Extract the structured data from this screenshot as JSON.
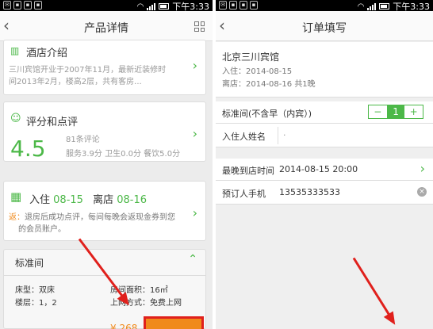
{
  "status_bar": {
    "time": "下午3:33"
  },
  "left": {
    "title": "产品详情",
    "intro": {
      "heading": "酒店介绍",
      "text_line1": "三川宾馆开业于2007年11月，最新近装修时",
      "text_line2": "间2013年2月，楼高2层，共有客房..."
    },
    "review": {
      "heading": "评分和点评",
      "score": "4.5",
      "count": "81条评论",
      "breakdown": "服务3.9分  卫生0.0分  餐饮5.0分"
    },
    "dates": {
      "checkin_label": "入住",
      "checkin_date": "08-15",
      "checkout_label": "离店",
      "checkout_date": "08-16",
      "promo_prefix": "返：",
      "promo_line1": "退房后成功点评，每间每晚会返现金券到您",
      "promo_line2": "的会员账户。"
    },
    "room": {
      "name": "标准间",
      "bed": "床型：双床",
      "area": "房间面积：16㎡",
      "floor": "楼层：1，2",
      "internet": "上网方式：免费上网",
      "price_partial": "¥ 268"
    }
  },
  "right": {
    "title": "订单填写",
    "hotel_name": "北京三川宾馆",
    "checkin_label": "入住：",
    "checkin": "2014-08-15",
    "checkout_label": "离店：",
    "checkout": "2014-08-16",
    "nights": "共1晚",
    "room_type": "标准间(不含早（内宾）)",
    "quantity": "1",
    "guest_label": "入住人姓名",
    "guest_value": "·",
    "arrival_label": "最晚到店时间",
    "arrival_value": "2014-08-15 20:00",
    "phone_label": "预订人手机",
    "phone_value": "13535333533"
  },
  "colors": {
    "accent": "#4cb848",
    "annotation": "#e0201c",
    "book_button": "#f08a1c"
  }
}
